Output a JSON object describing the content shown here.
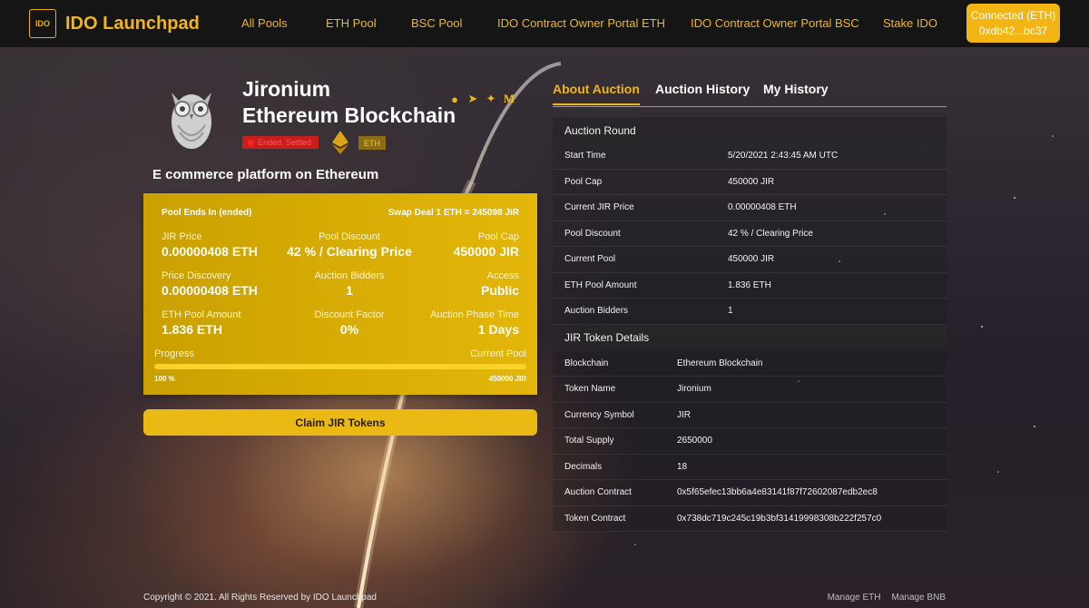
{
  "nav": {
    "logo_text": "IDO Launchpad",
    "logo_mark": "IDO",
    "links": [
      "All Pools",
      "ETH Pool",
      "BSC Pool",
      "IDO Contract Owner Portal ETH",
      "IDO Contract Owner Portal BSC",
      "Stake IDO"
    ],
    "connect": {
      "line1": "Connected (ETH)",
      "line2": "0xdb42...bc37"
    }
  },
  "project": {
    "name": "Jironium",
    "chain": "Ethereum Blockchain",
    "status_badge": "Ended. Settled",
    "network_badge": "ETH",
    "tagline": "E commerce platform on Ethereum",
    "social_icons": [
      "globe-icon",
      "telegram-icon",
      "twitter-icon",
      "medium-icon"
    ]
  },
  "pool": {
    "ends_label": "Pool Ends In  (ended)",
    "swap_deal": "Swap Deal 1 ETH = 245098 JIR",
    "stats": [
      {
        "label": "JIR Price",
        "value": "0.00000408 ETH"
      },
      {
        "label": "Pool Discount",
        "value": "42 % / Clearing Price"
      },
      {
        "label": "Pool Cap",
        "value": "450000 JIR"
      },
      {
        "label": "Price Discovery",
        "value": "0.00000408 ETH"
      },
      {
        "label": "Auction Bidders",
        "value": "1"
      },
      {
        "label": "Access",
        "value": "Public"
      },
      {
        "label": "ETH Pool Amount",
        "value": "1.836 ETH"
      },
      {
        "label": "Discount Factor",
        "value": "0%"
      },
      {
        "label": "Auction Phase Time",
        "value": "1 Days"
      }
    ],
    "progress_label": "Progress",
    "current_pool_label": "Current Pool",
    "progress_percent_text": "100 %",
    "progress_fraction": 1.0,
    "current_pool_value": "450000 JIR",
    "claim_button": "Claim JIR Tokens"
  },
  "tabs": [
    "About Auction",
    "Auction History",
    "My History"
  ],
  "auction_round": {
    "title": "Auction Round",
    "rows": [
      {
        "k": "Start Time",
        "v": "5/20/2021 2:43:45 AM UTC"
      },
      {
        "k": "Pool Cap",
        "v": "450000 JIR"
      },
      {
        "k": "Current JIR Price",
        "v": "0.00000408 ETH"
      },
      {
        "k": "Pool Discount",
        "v": "42 % / Clearing Price"
      },
      {
        "k": "Current Pool",
        "v": "450000 JIR"
      },
      {
        "k": "ETH Pool Amount",
        "v": "1.836 ETH"
      },
      {
        "k": "Auction Bidders",
        "v": "1"
      }
    ]
  },
  "token_details": {
    "title": "JIR Token Details",
    "rows": [
      {
        "k": "Blockchain",
        "v": "Ethereum Blockchain"
      },
      {
        "k": "Token Name",
        "v": "Jironium"
      },
      {
        "k": "Currency Symbol",
        "v": "JIR"
      },
      {
        "k": "Total Supply",
        "v": "2650000"
      },
      {
        "k": "Decimals",
        "v": "18"
      },
      {
        "k": "Auction Contract",
        "v": "0x5f65efec13bb6a4e83141f87f72602087edb2ec8"
      },
      {
        "k": "Token Contract",
        "v": "0x738dc719c245c19b3bf31419998308b222f257c0"
      }
    ]
  },
  "footer": {
    "copyright": "Copyright © 2021. All Rights Reserved by IDO Launchpad",
    "links": [
      "Manage ETH",
      "Manage BNB"
    ]
  },
  "colors": {
    "accent": "#f0b61a",
    "card": "#d7ac04",
    "danger": "#c81e1e"
  }
}
